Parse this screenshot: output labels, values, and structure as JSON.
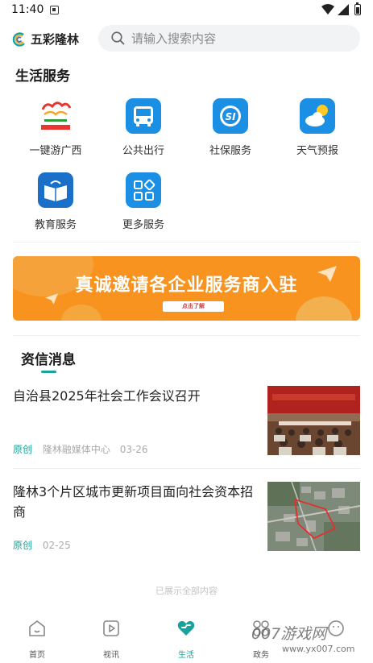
{
  "status_bar": {
    "time": "11:40"
  },
  "header": {
    "app_name": "五彩隆林",
    "search_placeholder": "请输入搜索内容"
  },
  "services": {
    "title": "生活服务",
    "items": [
      {
        "label": "一键游广西",
        "icon": "travel-guangxi-logo"
      },
      {
        "label": "公共出行",
        "icon": "bus-icon"
      },
      {
        "label": "社保服务",
        "icon": "social-security-icon"
      },
      {
        "label": "天气预报",
        "icon": "weather-icon"
      },
      {
        "label": "教育服务",
        "icon": "book-icon"
      },
      {
        "label": "更多服务",
        "icon": "grid-icon"
      }
    ]
  },
  "banner": {
    "text": "真诚邀请各企业服务商入驻",
    "cta": "点击了解",
    "color": "#f7931e"
  },
  "news": {
    "tab_label": "资信消息",
    "items": [
      {
        "title": "自治县2025年社会工作会议召开",
        "tag": "原创",
        "source": "隆林融媒体中心",
        "date": "03-26",
        "thumb": "conference-meeting-photo"
      },
      {
        "title": "隆林3个片区城市更新项目面向社会资本招商",
        "tag": "原创",
        "source": "",
        "date": "02-25",
        "thumb": "aerial-city-map-photo"
      }
    ],
    "end_text": "已展示全部内容"
  },
  "bottom_nav": {
    "items": [
      {
        "label": "首页",
        "icon": "home-icon",
        "active": false
      },
      {
        "label": "视讯",
        "icon": "video-icon",
        "active": false
      },
      {
        "label": "生活",
        "icon": "heart-icon",
        "active": true
      },
      {
        "label": "政务",
        "icon": "grid-circles-icon",
        "active": false
      },
      {
        "label": "",
        "icon": "profile-icon",
        "active": false
      }
    ]
  },
  "watermark": {
    "text": "007游戏网",
    "url": "www.yx007.com"
  },
  "colors": {
    "accent": "#1aa39a",
    "service_blue": "#1a8fe3",
    "banner_orange": "#f7931e"
  }
}
